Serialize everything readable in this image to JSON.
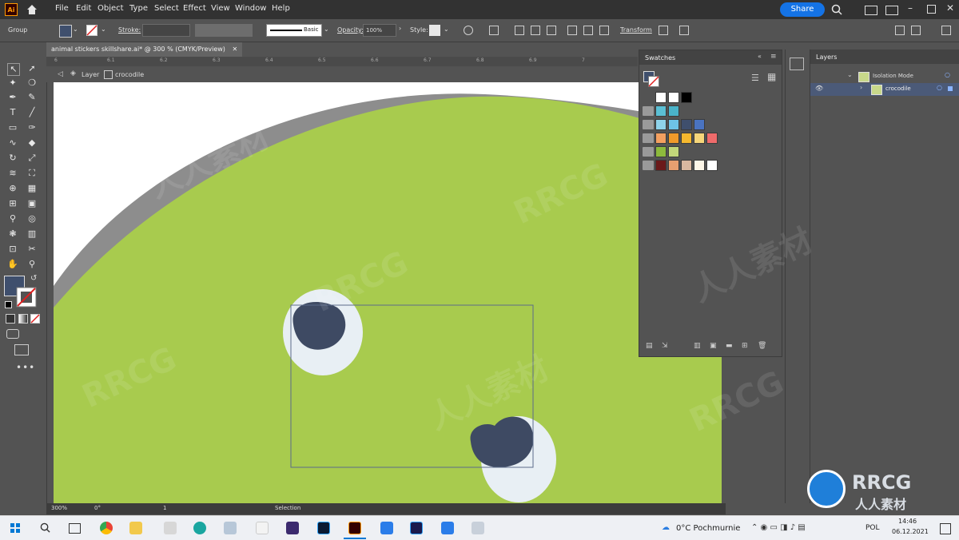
{
  "app": {
    "logo": "Ai"
  },
  "menu": [
    "File",
    "Edit",
    "Object",
    "Type",
    "Select",
    "Effect",
    "View",
    "Window",
    "Help"
  ],
  "share_label": "Share",
  "control": {
    "group_label": "Group",
    "stroke_label": "Stroke:",
    "stroke_profile": "Basic",
    "opacity_label": "Opacity:",
    "opacity_value": "100%",
    "style_label": "Style:",
    "transform_label": "Transform"
  },
  "document": {
    "tab_title": "animal stickers skillshare.ai* @ 300 % (CMYK/Preview)",
    "close": "✕",
    "breadcrumb": [
      "Layer",
      "crocodile"
    ]
  },
  "ruler_ticks": [
    "6",
    "6.1",
    "6.2",
    "6.3",
    "6.4",
    "6.5",
    "6.6",
    "6.7",
    "6.8",
    "6.9",
    "7"
  ],
  "swatches": {
    "title": "Swatches",
    "rows": [
      [
        "#ffffff",
        "#ffffff",
        "#000000"
      ],
      [
        "#5bbfd4",
        "#4ab3c9"
      ],
      [
        "#8fd3ea",
        "#6ec3e6",
        "#3f4f6d",
        "#4a73c0"
      ],
      [
        "#f4a060",
        "#f09a2a",
        "#f5b82e",
        "#f6d67a",
        "#ef6b6b"
      ],
      [
        "#8dba3c",
        "#c2d67a"
      ],
      [
        "#6b1a1a",
        "#e8a070",
        "#d9b8a0",
        "#fdf6e8",
        "#ffffff"
      ]
    ]
  },
  "layers": {
    "title": "Layers",
    "items": [
      {
        "name": "Isolation Mode"
      },
      {
        "name": "crocodile"
      }
    ]
  },
  "status": {
    "zoom": "300%",
    "rotation": "0°",
    "artboard": "1",
    "tool": "Selection"
  },
  "taskbar": {
    "weather": "0°C  Pochmurnie",
    "lang": "POL",
    "time": "14:46",
    "date": "06.12.2021"
  },
  "watermark": {
    "brand": "RRCG",
    "sub": "人人素材"
  },
  "colors": {
    "fill": "#3f4f6d",
    "green": "#a8cb4e",
    "gray_band": "#8d8d8d",
    "eye_white": "#e8eff4",
    "pupil": "#3e4a63",
    "accent": "#1473e6"
  }
}
